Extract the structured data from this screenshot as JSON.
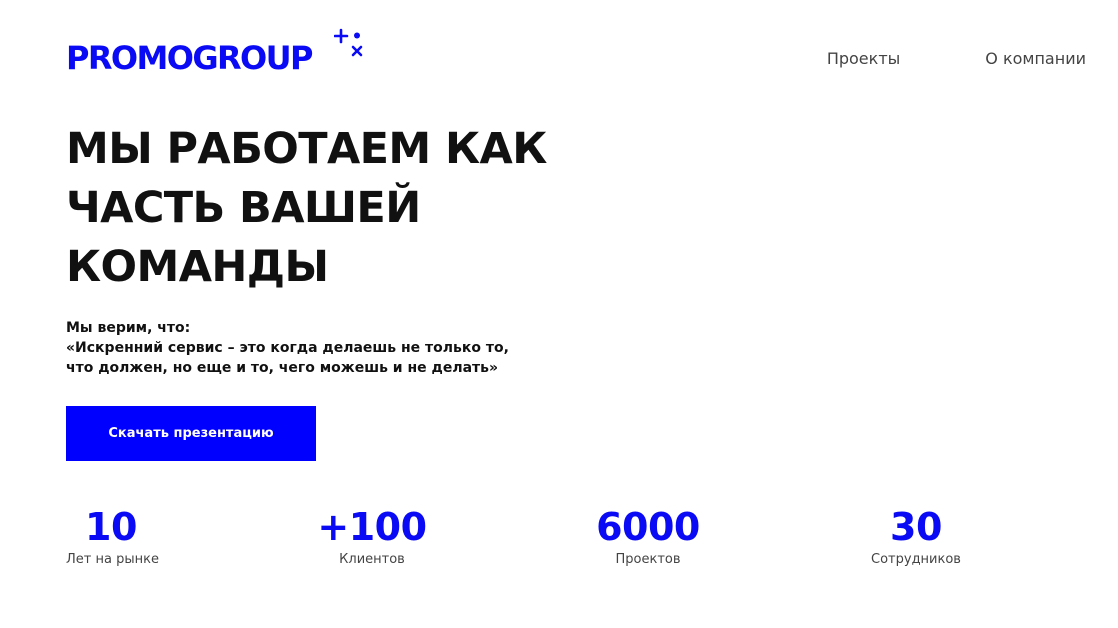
{
  "header": {
    "logo_text": "PROMOGROUP",
    "brand_color": "#0a0af5",
    "nav": [
      {
        "label": "Проекты"
      },
      {
        "label": "О компании"
      }
    ]
  },
  "hero": {
    "title_lines": [
      "МЫ РАБОТАЕМ КАК",
      "ЧАСТЬ ВАШЕЙ",
      "КОМАНДЫ"
    ],
    "belief_lines": [
      "Мы верим, что:",
      "«Искренний сервис – это когда делаешь не только то,",
      "что должен, но еще и то, чего можешь и не делать»"
    ],
    "cta_label": "Скачать презентацию",
    "cta_color": "#0000ff"
  },
  "stats": [
    {
      "value": "10",
      "label": "Лет на рынке"
    },
    {
      "value": "+100",
      "label": "Клиентов"
    },
    {
      "value": "6000",
      "label": "Проектов"
    },
    {
      "value": "30",
      "label": "Сотрудников"
    }
  ]
}
